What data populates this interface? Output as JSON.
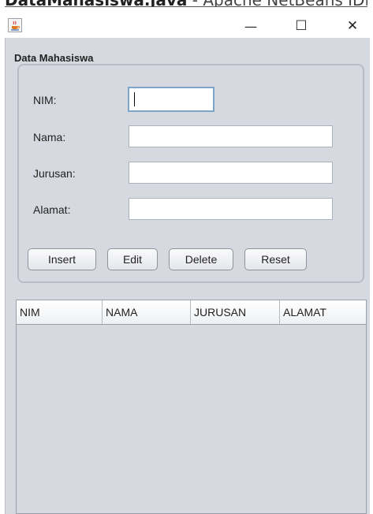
{
  "window": {
    "clipped_title": "DataMahasiswa.java",
    "clipped_title_suffix": " - Apache NetBeans IDE",
    "app_icon": "java-coffee-cup-icon",
    "minimize_glyph": "—",
    "maximize_glyph": "☐",
    "close_glyph": "✕"
  },
  "form": {
    "group_title": "Data Mahasiswa",
    "fields": {
      "nim": {
        "label": "NIM:",
        "value": ""
      },
      "nama": {
        "label": "Nama:",
        "value": ""
      },
      "jurusan": {
        "label": "Jurusan:",
        "value": ""
      },
      "alamat": {
        "label": "Alamat:",
        "value": ""
      }
    },
    "buttons": {
      "insert": "Insert",
      "edit": "Edit",
      "delete": "Delete",
      "reset": "Reset"
    }
  },
  "table": {
    "columns": [
      "NIM",
      "NAMA",
      "JURUSAN",
      "ALAMAT"
    ],
    "rows": []
  },
  "colors": {
    "panel_bg": "#d6d9df",
    "focus_border": "#7da4c9"
  }
}
